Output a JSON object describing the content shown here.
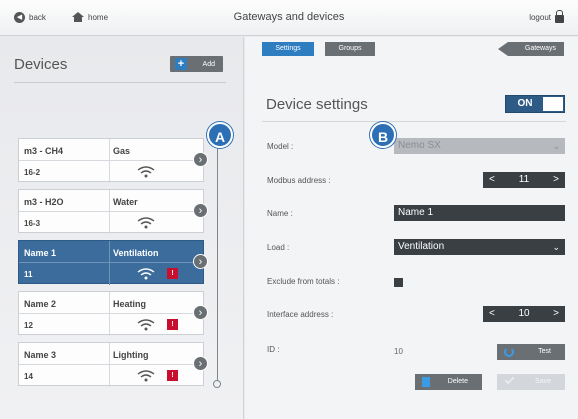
{
  "topbar": {
    "back_label": "back",
    "home_label": "home",
    "title": "Gateways and devices",
    "logout_label": "logout"
  },
  "nav": {
    "settings_tab": "Settings",
    "groups_tab": "Groups",
    "gateways_button": "Gateways"
  },
  "devices": {
    "title": "Devices",
    "add_label": "Add",
    "items": [
      {
        "name": "m3 - CH4",
        "type": "Gas",
        "address": "16-2",
        "alert": false
      },
      {
        "name": "m3 - H2O",
        "type": "Water",
        "address": "16-3",
        "alert": false
      },
      {
        "name": "Name 1",
        "type": "Ventilation",
        "address": "11",
        "alert": true,
        "selected": true
      },
      {
        "name": "Name 2",
        "type": "Heating",
        "address": "12",
        "alert": true
      },
      {
        "name": "Name 3",
        "type": "Lighting",
        "address": "14",
        "alert": true
      }
    ],
    "alert_glyph": "!"
  },
  "badges": {
    "a": "A",
    "b": "B"
  },
  "settings": {
    "title": "Device settings",
    "toggle_label": "ON",
    "model_label": "Model :",
    "model_value": "Nemo SX",
    "modbus_label": "Modbus address :",
    "modbus_value": "11",
    "name_label": "Name :",
    "name_value": "Name 1",
    "load_label": "Load :",
    "load_value": "Ventilation",
    "exclude_label": "Exclude from totals :",
    "interface_label": "Interface address :",
    "interface_value": "10",
    "id_label": "ID :",
    "id_value": "10",
    "test_label": "Test",
    "delete_label": "Delete",
    "save_label": "Save"
  },
  "colors": {
    "accent_blue": "#2f7dc1",
    "selected_row": "#3b6c9c",
    "dark_control": "#3a3f44",
    "alert_red": "#c8102e"
  }
}
